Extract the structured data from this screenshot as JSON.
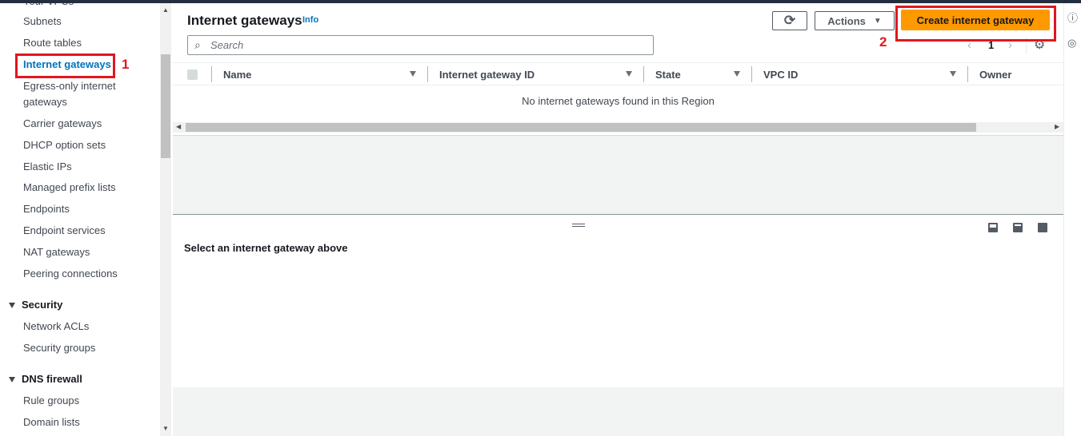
{
  "sidebar": {
    "clipped": "Your VPCs",
    "items": [
      "Subnets",
      "Route tables",
      "Internet gateways",
      "Egress-only internet gateways",
      "Carrier gateways",
      "DHCP option sets",
      "Elastic IPs",
      "Managed prefix lists",
      "Endpoints",
      "Endpoint services",
      "NAT gateways",
      "Peering connections"
    ],
    "security": {
      "label": "Security",
      "items": [
        "Network ACLs",
        "Security groups"
      ]
    },
    "dns": {
      "label": "DNS firewall",
      "items": [
        "Rule groups",
        "Domain lists"
      ]
    }
  },
  "header": {
    "title": "Internet gateways",
    "info": "Info",
    "actions": "Actions",
    "create": "Create internet gateway",
    "search_placeholder": "Search",
    "page": "1"
  },
  "table": {
    "columns": [
      "Name",
      "Internet gateway ID",
      "State",
      "VPC ID",
      "Owner"
    ],
    "empty": "No internet gateways found in this Region"
  },
  "detail": {
    "prompt": "Select an internet gateway above"
  },
  "annotations": {
    "one": "1",
    "two": "2",
    "color": "#e0161f"
  },
  "colors": {
    "primary": "#ff9900",
    "link": "#0073bb"
  }
}
